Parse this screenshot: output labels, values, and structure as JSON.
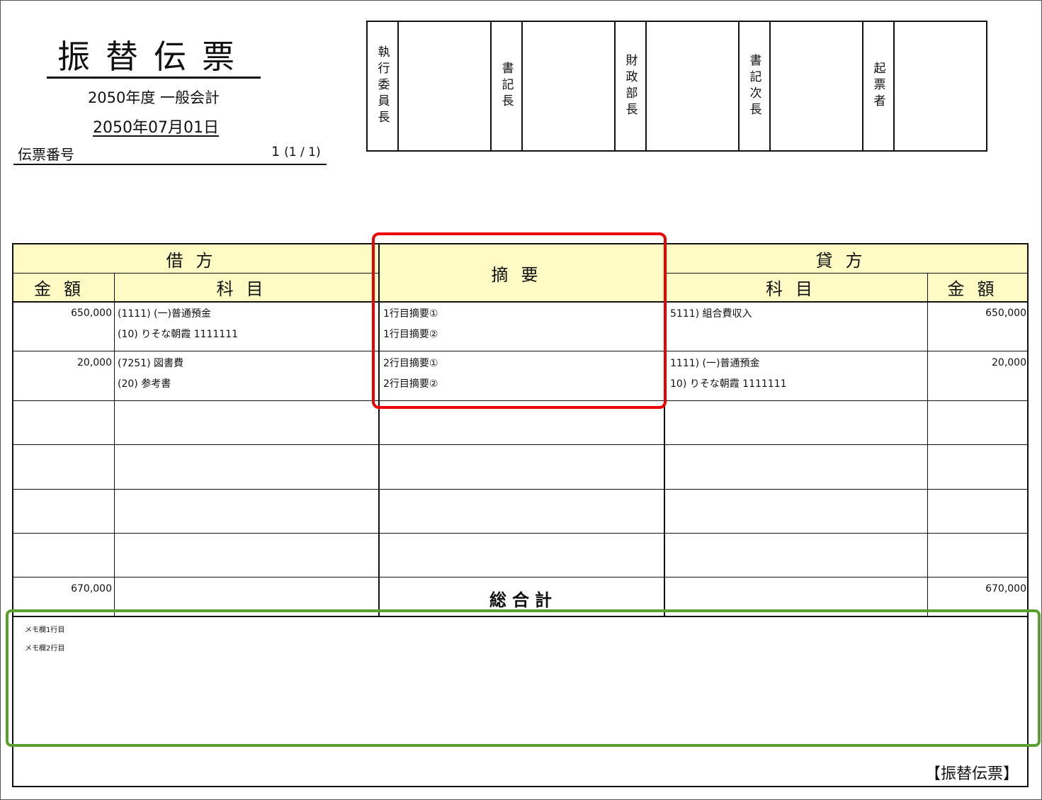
{
  "header": {
    "title": "振替伝票",
    "fiscal_year": "2050年度 一般会計",
    "date": "2050年07月01日",
    "slip_number_label": "伝票番号",
    "slip_number": "1",
    "slip_page": "(1 / 1)"
  },
  "approvals": [
    "執行委員長",
    "書記長",
    "財政部長",
    "書記次長",
    "起票者"
  ],
  "columns": {
    "debit": "借方",
    "credit": "貸方",
    "amount": "金額",
    "account": "科目",
    "summary": "摘要"
  },
  "rows": [
    {
      "debit_amount": "650,000",
      "debit_account_1": "(1111) (一)普通預金",
      "debit_account_2": "(10) りそな朝霞 1111111",
      "summary_1": "1行目摘要①",
      "summary_2": "1行目摘要②",
      "credit_account_1": "5111) 組合費収入",
      "credit_account_2": "",
      "credit_amount": "650,000"
    },
    {
      "debit_amount": "20,000",
      "debit_account_1": "(7251) 図書費",
      "debit_account_2": "(20) 参考書",
      "summary_1": "2行目摘要①",
      "summary_2": "2行目摘要②",
      "credit_account_1": "1111) (一)普通預金",
      "credit_account_2": "10) りそな朝霞 1111111",
      "credit_amount": "20,000"
    }
  ],
  "totals": {
    "label": "総合計",
    "debit": "670,000",
    "credit": "670,000"
  },
  "memo": [
    "メモ欄1行目",
    "メモ欄2行目"
  ],
  "footer": "【振替伝票】",
  "colors": {
    "header_fill": "#fdfac3",
    "annotation_red": "#e00000",
    "annotation_green": "#5aa02c"
  }
}
